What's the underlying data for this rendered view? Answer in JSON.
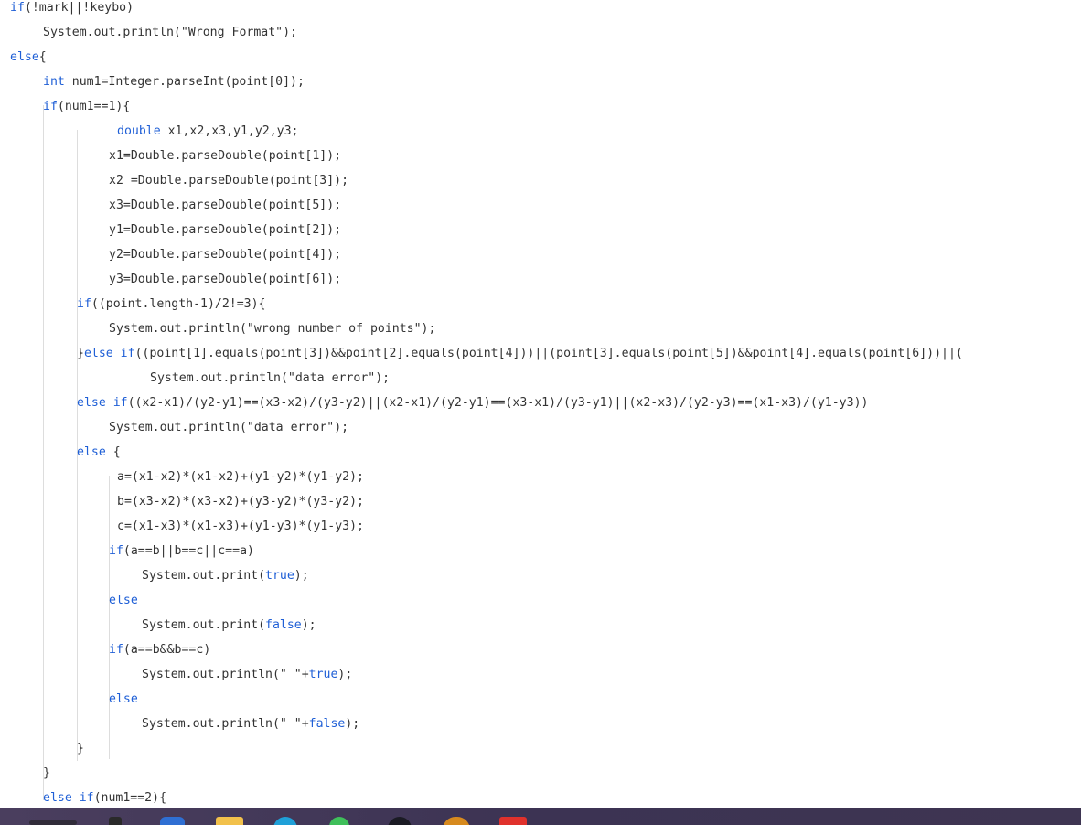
{
  "code_lines": [
    "if(!mark||!keybo)",
    "System.out.println(\"Wrong Format\");",
    "else{",
    "int num1=Integer.parseInt(point[0]);",
    "if(num1==1){",
    "double x1,x2,x3,y1,y2,y3;",
    "x1=Double.parseDouble(point[1]);",
    "x2 =Double.parseDouble(point[3]);",
    "x3=Double.parseDouble(point[5]);",
    "y1=Double.parseDouble(point[2]);",
    "y2=Double.parseDouble(point[4]);",
    "y3=Double.parseDouble(point[6]);",
    "if((point.length-1)/2!=3){",
    "System.out.println(\"wrong number of points\");",
    "}else if((point[1].equals(point[3])&&point[2].equals(point[4]))||(point[3].equals(point[5])&&point[4].equals(point[6]))||(",
    "System.out.println(\"data error\");",
    "else if((x2-x1)/(y2-y1)==(x3-x2)/(y3-y2)||(x2-x1)/(y2-y1)==(x3-x1)/(y3-y1)||(x2-x3)/(y2-y3)==(x1-x3)/(y1-y3))",
    "System.out.println(\"data error\");",
    "else {",
    "a=(x1-x2)*(x1-x2)+(y1-y2)*(y1-y2);",
    "b=(x3-x2)*(x3-x2)+(y3-y2)*(y3-y2);",
    "c=(x1-x3)*(x1-x3)+(y1-y3)*(y1-y3);",
    "if(a==b||b==c||c==a)",
    "System.out.print(true);",
    "else",
    "System.out.print(false);",
    "if(a==b&&b==c)",
    "System.out.println(\" \"+true);",
    "else",
    "System.out.println(\" \"+false);",
    "}",
    "}",
    "else if(num1==2){"
  ],
  "keywords": [
    "if",
    "else",
    "int",
    "double",
    "true",
    "false"
  ],
  "colors": {
    "keyword": "#1f5fd6",
    "text": "#333333",
    "background": "#ffffff",
    "taskbar": "#3e3552"
  },
  "taskbar_icons": [
    "widgets-icon",
    "close-icon",
    "shield-icon",
    "folder-icon",
    "edge-browser-icon",
    "green-app-icon",
    "steam-icon",
    "moon-icon",
    "red-app-icon"
  ]
}
